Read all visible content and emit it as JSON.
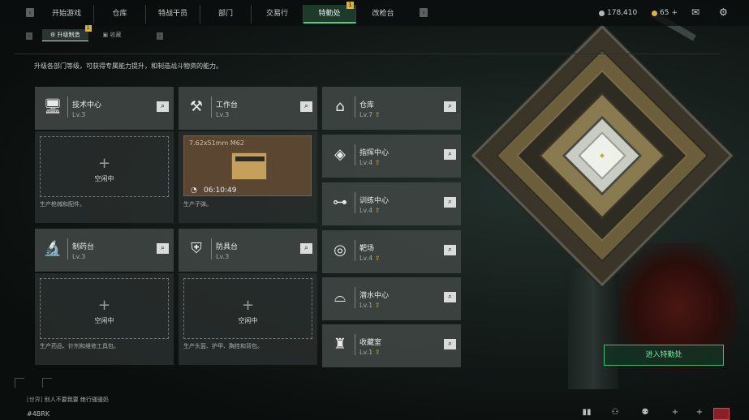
{
  "header": {
    "tabs": [
      {
        "label": "开始游戏",
        "active": false
      },
      {
        "label": "仓库",
        "active": false
      },
      {
        "label": "特战干员",
        "active": false
      },
      {
        "label": "部门",
        "active": false
      },
      {
        "label": "交易行",
        "active": false
      },
      {
        "label": "特勤处",
        "active": true,
        "badge": "1"
      },
      {
        "label": "改枪台",
        "active": false
      }
    ],
    "currency_silver": "178,410",
    "currency_gold": "65",
    "currency_plus": "+"
  },
  "subtabs": [
    {
      "label": "升级制造",
      "badge": "1",
      "active": true
    },
    {
      "label": "收藏",
      "active": false
    }
  ],
  "description": "升级各部门等级，可获得专属能力提升，和制造战斗物资的能力。",
  "workshops": [
    {
      "title": "技术中心",
      "level": "Lv.3",
      "icon": "computer-icon",
      "note": "生产枪械和配件。",
      "status": "空闲中"
    },
    {
      "title": "工作台",
      "level": "Lv.3",
      "icon": "tools-icon",
      "note": "生产子弹。",
      "producing": {
        "item": "7.62x51mm M62",
        "timer": "06:10:49"
      }
    },
    {
      "title": "制药台",
      "level": "Lv.3",
      "icon": "microscope-icon",
      "note": "生产药品、针剂和维修工具包。",
      "status": "空闲中"
    },
    {
      "title": "防具台",
      "level": "Lv.3",
      "icon": "armor-icon",
      "note": "生产头盔、护甲、胸挂和背包。",
      "status": "空闲中"
    }
  ],
  "facilities": [
    {
      "title": "仓库",
      "level": "Lv.7",
      "icon": "warehouse-icon"
    },
    {
      "title": "指挥中心",
      "level": "Lv.4",
      "icon": "command-icon"
    },
    {
      "title": "训练中心",
      "level": "Lv.4",
      "icon": "dumbbell-icon"
    },
    {
      "title": "靶场",
      "level": "Lv.4",
      "icon": "target-icon"
    },
    {
      "title": "潜水中心",
      "level": "Lv.1",
      "icon": "dive-mask-icon"
    },
    {
      "title": "收藏室",
      "level": "Lv.1",
      "icon": "trophy-room-icon"
    }
  ],
  "enter_button": "进入特勤处",
  "chat": {
    "channel": "[世界]",
    "text": "别人不要我要  绝行骚骚奶"
  },
  "bottom_tag": "#4BRK",
  "colors": {
    "accent": "#4fcf82",
    "badge": "#d9b33a",
    "card": "#3e4442"
  }
}
